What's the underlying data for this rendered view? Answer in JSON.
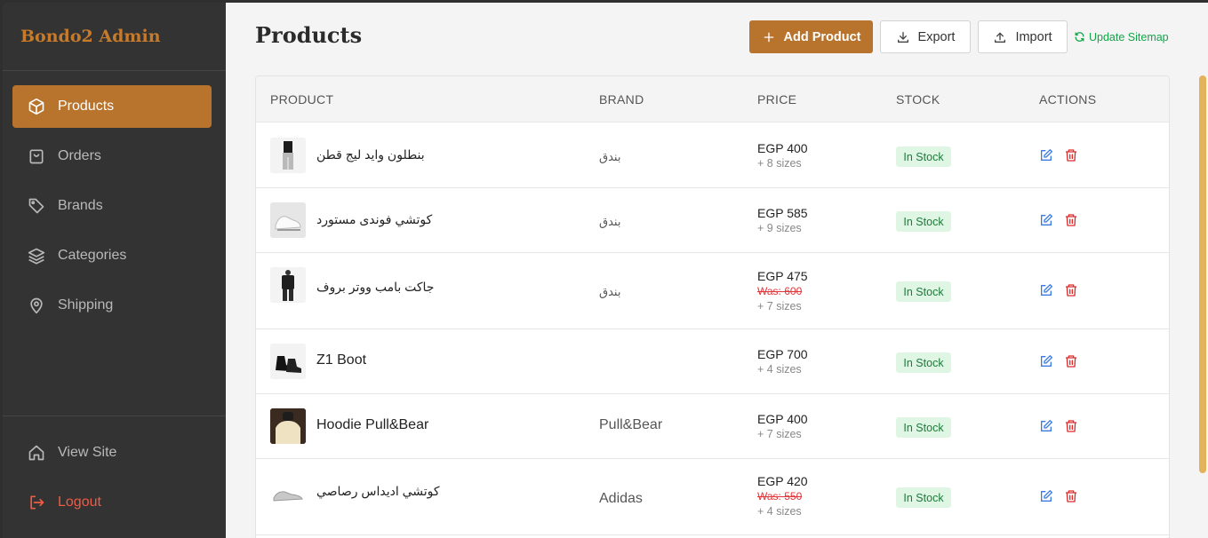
{
  "sidebar": {
    "brand": "Bondo2 Admin",
    "items": [
      {
        "label": "Products",
        "icon": "box-icon",
        "active": true
      },
      {
        "label": "Orders",
        "icon": "shopping-bag-icon"
      },
      {
        "label": "Brands",
        "icon": "tag-icon"
      },
      {
        "label": "Categories",
        "icon": "layers-icon"
      },
      {
        "label": "Shipping",
        "icon": "map-pin-icon"
      }
    ],
    "bottom": [
      {
        "label": "View Site",
        "icon": "home-icon"
      },
      {
        "label": "Logout",
        "icon": "logout-icon"
      }
    ]
  },
  "header": {
    "title": "Products",
    "add_label": "Add Product",
    "export_label": "Export",
    "import_label": "Import",
    "sitemap_label": "Update Sitemap"
  },
  "table": {
    "columns": [
      "PRODUCT",
      "BRAND",
      "PRICE",
      "STOCK",
      "ACTIONS"
    ],
    "rows": [
      {
        "name": "بنطلون وايد ليج قطن",
        "brand": "بندق",
        "price": "EGP 400",
        "was": "",
        "sizes": "+ 8 sizes",
        "stock": "In Stock",
        "thumb": "pants"
      },
      {
        "name": "كوتشي فوندى مستورد",
        "brand": "بندق",
        "price": "EGP 585",
        "was": "",
        "sizes": "+ 9 sizes",
        "stock": "In Stock",
        "thumb": "sneaker"
      },
      {
        "name": "جاكت بامب ووتر بروف",
        "brand": "بندق",
        "price": "EGP 475",
        "was": "Was: 600",
        "sizes": "+ 7 sizes",
        "stock": "In Stock",
        "thumb": "jacket"
      },
      {
        "name": "Z1 Boot",
        "brand": "",
        "price": "EGP 700",
        "was": "",
        "sizes": "+ 4 sizes",
        "stock": "In Stock",
        "thumb": "boot"
      },
      {
        "name": "Hoodie Pull&Bear",
        "brand": "Pull&Bear",
        "price": "EGP 400",
        "was": "",
        "sizes": "+ 7 sizes",
        "stock": "In Stock",
        "thumb": "hoodie"
      },
      {
        "name": "كوتشي اديداس رصاصي",
        "brand": "Adidas",
        "price": "EGP 420",
        "was": "Was: 550",
        "sizes": "+ 4 sizes",
        "stock": "In Stock",
        "thumb": "gray-sneaker"
      }
    ]
  },
  "colors": {
    "accent": "#b8732c",
    "sidebar_bg": "#333333",
    "stock_badge_bg": "#dff6e4",
    "edit_icon": "#3b7be0",
    "delete_icon": "#d92c2c",
    "sitemap": "#15a34a"
  }
}
